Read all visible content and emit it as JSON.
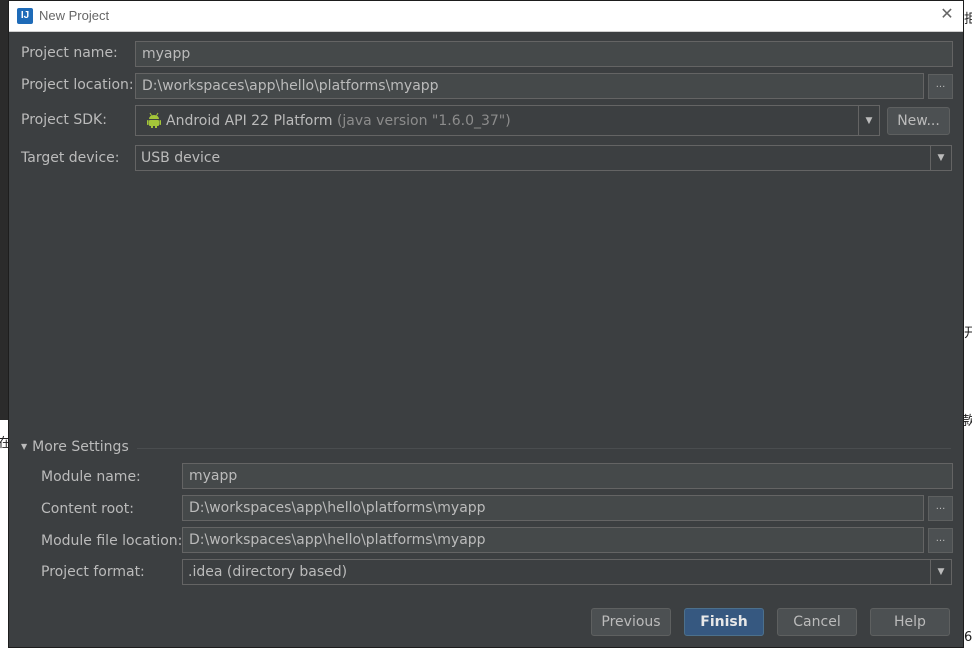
{
  "window": {
    "title": "New Project"
  },
  "background": {
    "frag_top_right": "拒",
    "frag_mid_right": "开",
    "frag_low_right": "款",
    "frag_left_mid": "在",
    "frag_bottom_right": "6"
  },
  "form": {
    "project_name": {
      "label": "Project name:",
      "value": "myapp"
    },
    "project_location": {
      "label": "Project location:",
      "value": "D:\\workspaces\\app\\hello\\platforms\\myapp",
      "browse": "..."
    },
    "project_sdk": {
      "label": "Project SDK:",
      "value": "Android API 22 Platform",
      "hint": "(java version \"1.6.0_37\")",
      "new_button": "New..."
    },
    "target_device": {
      "label": "Target device:",
      "value": "USB device"
    }
  },
  "more_settings": {
    "header": "More Settings",
    "module_name": {
      "label": "Module name:",
      "value": "myapp"
    },
    "content_root": {
      "label": "Content root:",
      "value": "D:\\workspaces\\app\\hello\\platforms\\myapp",
      "browse": "..."
    },
    "module_file_location": {
      "label": "Module file location:",
      "value": "D:\\workspaces\\app\\hello\\platforms\\myapp",
      "browse": "..."
    },
    "project_format": {
      "label": "Project format:",
      "value": ".idea (directory based)"
    }
  },
  "buttons": {
    "previous": "Previous",
    "finish": "Finish",
    "cancel": "Cancel",
    "help": "Help"
  },
  "colors": {
    "dialog_bg": "#3c3f41",
    "field_bg": "#45494a",
    "primary_button": "#365880",
    "android_green": "#a4c639"
  },
  "icons": {
    "app": "intellij-idea-icon",
    "close": "close-icon",
    "sdk": "android-icon",
    "expand": "triangle-down-icon",
    "dropdown": "chevron-down-icon"
  }
}
